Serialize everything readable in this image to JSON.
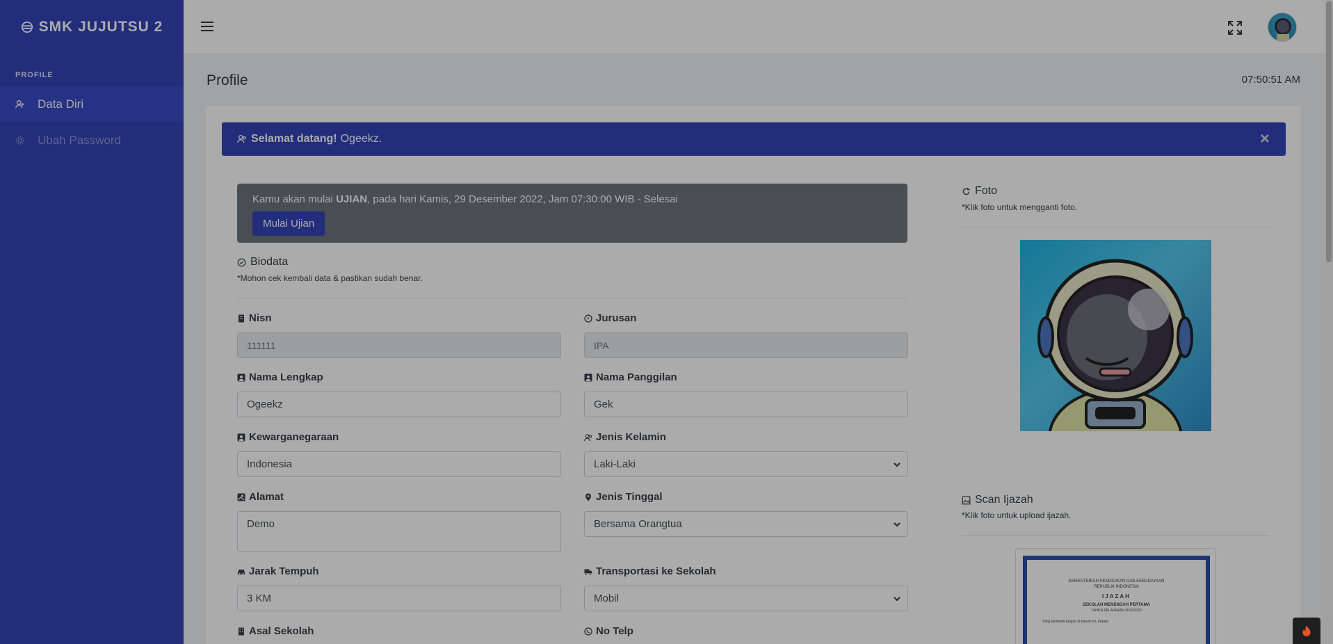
{
  "app": {
    "brand": "SMK JUJUTSU 2"
  },
  "sidebar": {
    "heading": "PROFILE",
    "items": [
      {
        "label": "Data Diri",
        "icon": "user-icon",
        "active": true
      },
      {
        "label": "Ubah Password",
        "icon": "gear-icon",
        "active": false
      }
    ]
  },
  "header": {
    "page_title": "Profile",
    "clock": "07:50:51 AM"
  },
  "welcome": {
    "greeting": "Selamat datang!",
    "name": "Ogeekz."
  },
  "exam": {
    "text_before": "Kamu akan mulai ",
    "text_bold": "UJIAN",
    "text_after": ", pada hari Kamis, 29 Desember 2022, Jam 07:30:00 WIB - Selesai",
    "button_label": "Mulai Ujian"
  },
  "biodata": {
    "title": "Biodata",
    "note": "*Mohon cek kembali data & pastikan sudah benar.",
    "fields": {
      "nisn": {
        "label": "Nisn",
        "value": "111111"
      },
      "jurusan": {
        "label": "Jurusan",
        "value": "IPA"
      },
      "nama_lengkap": {
        "label": "Nama Lengkap",
        "value": "Ogeekz"
      },
      "nama_panggilan": {
        "label": "Nama Panggilan",
        "value": "Gek"
      },
      "kewarganegaraan": {
        "label": "Kewarganegaraan",
        "value": "Indonesia"
      },
      "jenis_kelamin": {
        "label": "Jenis Kelamin",
        "value": "Laki-Laki"
      },
      "alamat": {
        "label": "Alamat",
        "value": "Demo"
      },
      "jenis_tinggal": {
        "label": "Jenis Tinggal",
        "value": "Bersama Orangtua"
      },
      "jarak_tempuh": {
        "label": "Jarak Tempuh",
        "value": "3 KM"
      },
      "transportasi": {
        "label": "Transportasi ke Sekolah",
        "value": "Mobil"
      },
      "asal_sekolah": {
        "label": "Asal Sekolah"
      },
      "no_telp": {
        "label": "No Telp"
      }
    }
  },
  "foto": {
    "title": "Foto",
    "note": "*Klik foto untuk mengganti foto."
  },
  "ijazah": {
    "title": "Scan Ijazah",
    "note": "*Klik foto untuk upload ijazah.",
    "doc_line1": "KEMENTERIAN PENDIDIKAN DAN KEBUDAYAAN",
    "doc_line2": "REPUBLIK INDONESIA",
    "doc_title": "IJAZAH",
    "doc_school": "SEKOLAH MENENGAH PERTAMA",
    "doc_year": "TAHUN PELAJARAN 2019/2020",
    "doc_body": "Yang bertanda tangan di bawah ini, Kepala"
  },
  "colors": {
    "primary": "#3343b9",
    "secondary": "#6c757d"
  }
}
